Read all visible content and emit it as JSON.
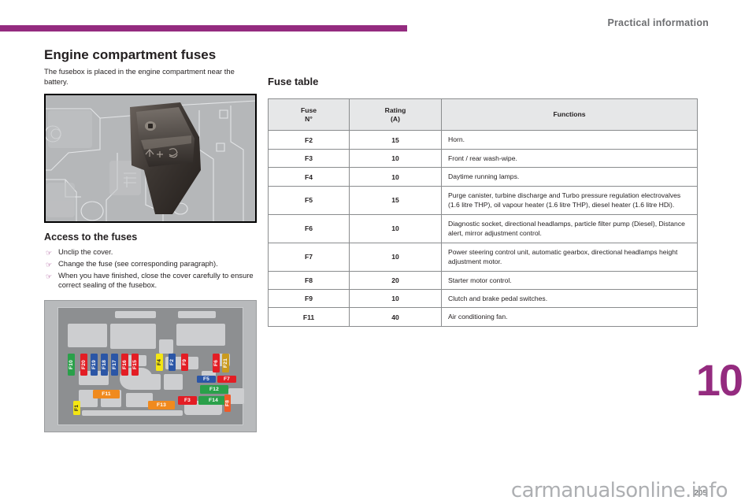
{
  "header": {
    "title": "Practical information"
  },
  "chapter_tab": "10",
  "left": {
    "heading": "Engine compartment fuses",
    "intro": "The fusebox is placed in the engine compartment near the battery.",
    "access_heading": "Access to the fuses",
    "bullets": [
      "Unclip the cover.",
      "Change the fuse (see corresponding paragraph).",
      "When you have finished, close the cover carefully to ensure correct sealing of the fusebox."
    ],
    "photo_alt": "Engine compartment fusebox cover",
    "fusebox_labels": [
      "F10",
      "F20",
      "F19",
      "F18",
      "F17",
      "F16",
      "F15",
      "F4",
      "F2",
      "F9",
      "F6",
      "F21",
      "F5",
      "F7",
      "F12",
      "F3",
      "F14",
      "F8",
      "F11",
      "F1",
      "F13"
    ]
  },
  "right": {
    "heading": "Fuse table",
    "columns": [
      "Fuse\nN°",
      "Rating\n(A)",
      "Functions"
    ],
    "column_fuse_line1": "Fuse",
    "column_fuse_line2": "N°",
    "column_rating_line1": "Rating",
    "column_rating_line2": "(A)",
    "column_functions": "Functions",
    "rows": [
      {
        "fuse": "F2",
        "rating": "15",
        "functions": "Horn."
      },
      {
        "fuse": "F3",
        "rating": "10",
        "functions": "Front / rear wash-wipe."
      },
      {
        "fuse": "F4",
        "rating": "10",
        "functions": "Daytime running lamps."
      },
      {
        "fuse": "F5",
        "rating": "15",
        "functions": "Purge canister, turbine discharge and Turbo pressure regulation electrovalves (1.6 litre THP), oil vapour heater (1.6 litre THP), diesel heater (1.6 litre HDi)."
      },
      {
        "fuse": "F6",
        "rating": "10",
        "functions": "Diagnostic socket, directional headlamps, particle filter pump (Diesel), Distance alert, mirror adjustment control."
      },
      {
        "fuse": "F7",
        "rating": "10",
        "functions": "Power steering control unit, automatic gearbox, directional headlamps height adjustment motor."
      },
      {
        "fuse": "F8",
        "rating": "20",
        "functions": "Starter motor control."
      },
      {
        "fuse": "F9",
        "rating": "10",
        "functions": "Clutch and brake pedal switches."
      },
      {
        "fuse": "F11",
        "rating": "40",
        "functions": "Air conditioning fan."
      }
    ]
  },
  "footer": {
    "page_number": "205",
    "watermark": "carmanualsonline.info"
  },
  "colors": {
    "accent": "#942b7f",
    "header_grey": "#6d6e71",
    "table_header_bg": "#e6e7e8",
    "table_border": "#8a8c8e",
    "fuse_green": "#2aa04a",
    "fuse_red": "#e31d24",
    "fuse_blue": "#2b56a6",
    "fuse_yellow": "#f4e613",
    "fuse_gold": "#c99a1e",
    "fuse_orange": "#f08a1e"
  }
}
